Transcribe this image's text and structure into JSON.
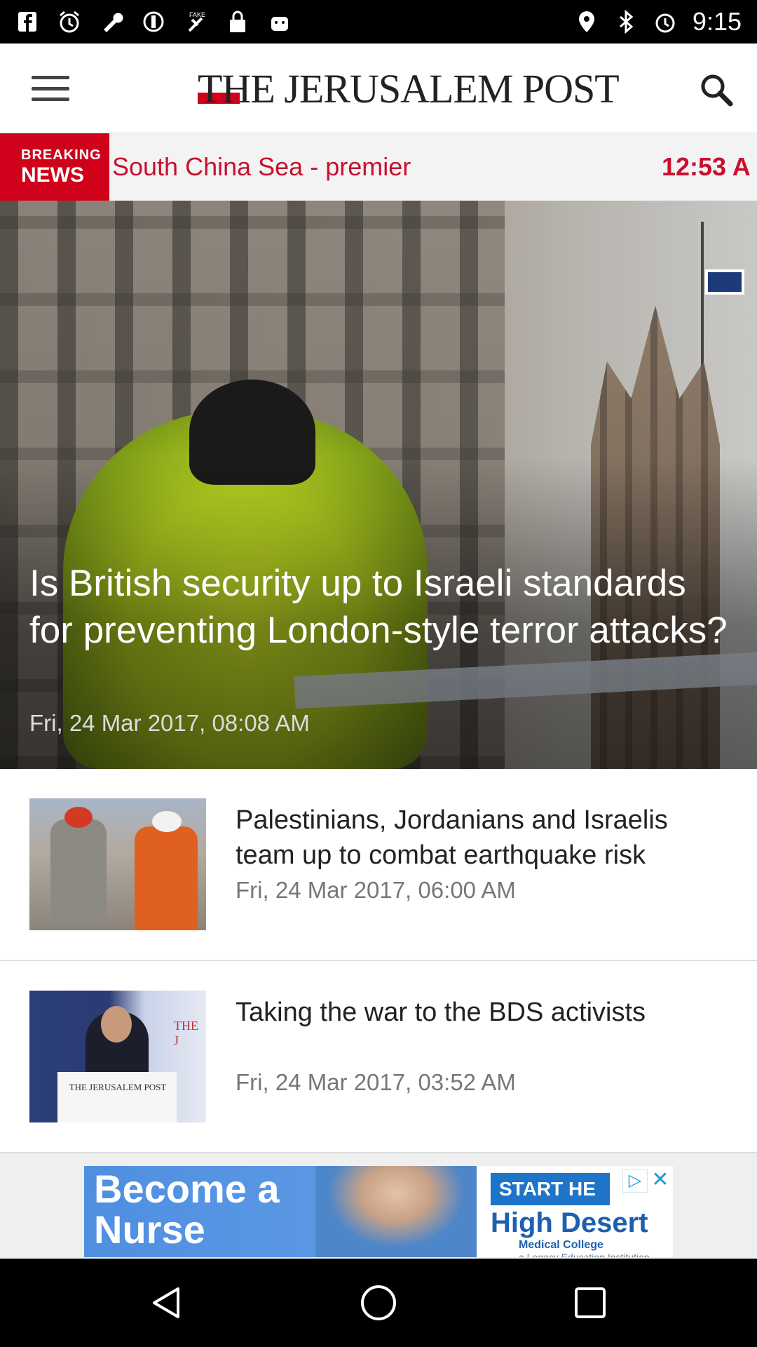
{
  "status_bar": {
    "time": "9:15",
    "left_icons": [
      "facebook-icon",
      "alarm-icon",
      "wrench-icon",
      "settings-icon",
      "fake-gps-icon",
      "lock-icon",
      "android-icon"
    ],
    "right_icons": [
      "location-icon",
      "bluetooth-icon",
      "alarm-icon"
    ]
  },
  "header": {
    "logo_text": "THE JERUSALEM POST",
    "menu_icon": "hamburger-menu-icon",
    "search_icon": "search-icon"
  },
  "breaking_news": {
    "badge_line1": "BREAKING",
    "badge_line2": "NEWS",
    "headline": "South China Sea - premier",
    "time": "12:53 A"
  },
  "hero": {
    "title": "Is British security up to Israeli standards for preventing London-style terror attacks?",
    "date": "Fri, 24 Mar 2017, 08:08 AM"
  },
  "articles": [
    {
      "title": "Palestinians, Jordanians and Israelis team up to combat earthquake risk",
      "date": "Fri, 24 Mar 2017, 06:00 AM"
    },
    {
      "title": "Taking the war to the BDS activists",
      "date": "Fri, 24 Mar 2017, 03:52 AM",
      "thumb_text": "THE JERUSALEM POST",
      "thumb_brand": "THE J"
    }
  ],
  "ad": {
    "left_text": "Become a Nurse",
    "start_text": "START HE",
    "college_line1": "High Desert",
    "college_line2": "Medical College",
    "sub_text": "a Legacy Education Institution"
  },
  "colors": {
    "brand_red": "#d0021b",
    "ticker_red": "#c8102e"
  }
}
